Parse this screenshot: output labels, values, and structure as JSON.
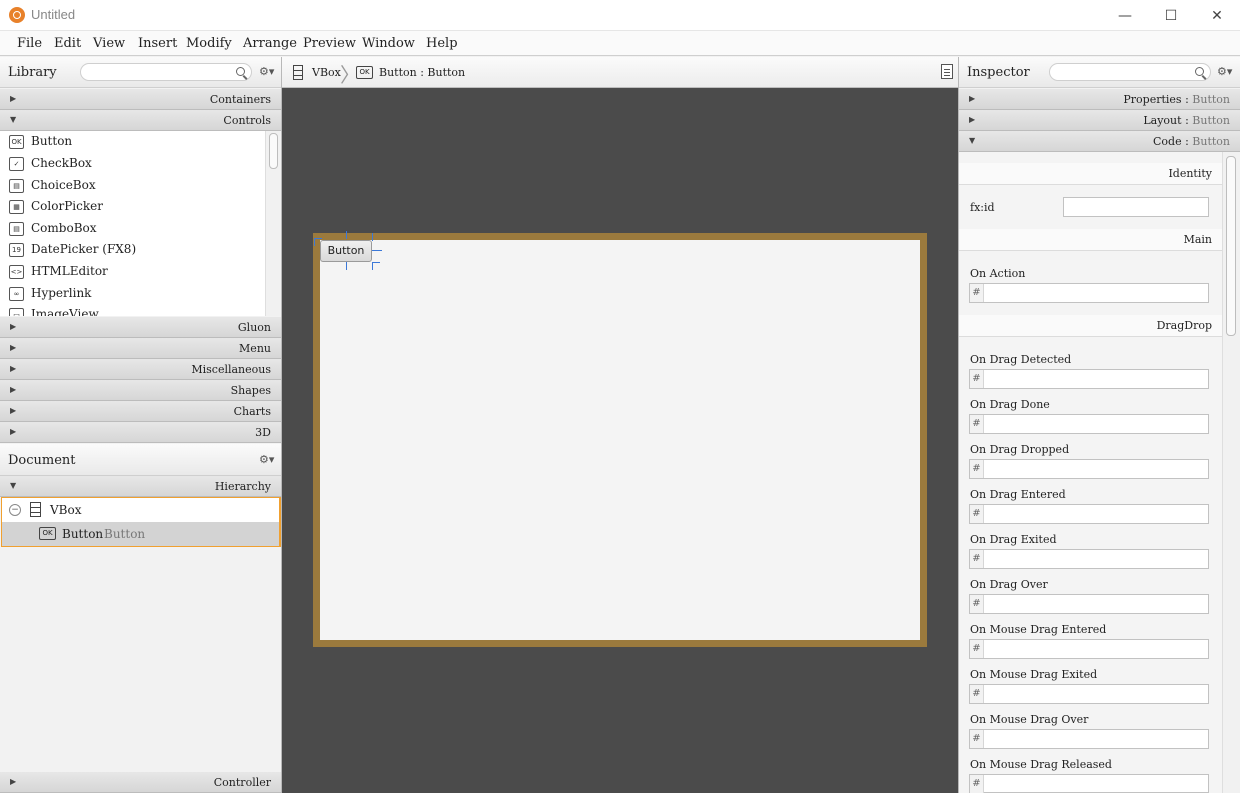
{
  "window": {
    "title": "Untitled",
    "controls": [
      "minimize",
      "maximize",
      "close"
    ]
  },
  "menu": [
    "File",
    "Edit",
    "View",
    "Insert",
    "Modify",
    "Arrange",
    "Preview",
    "Window",
    "Help"
  ],
  "library": {
    "title": "Library",
    "search_placeholder": "",
    "sections_top": [
      "Containers",
      "Controls"
    ],
    "controls": [
      {
        "label": "Button",
        "icon": "OK"
      },
      {
        "label": "CheckBox",
        "icon": "✓"
      },
      {
        "label": "ChoiceBox",
        "icon": "▤"
      },
      {
        "label": "ColorPicker",
        "icon": "▦"
      },
      {
        "label": "ComboBox",
        "icon": "▤"
      },
      {
        "label": "DatePicker  (FX8)",
        "icon": "19"
      },
      {
        "label": "HTMLEditor",
        "icon": "<>"
      },
      {
        "label": "Hyperlink",
        "icon": "∞"
      },
      {
        "label": "ImageView",
        "icon": "▭"
      }
    ],
    "sections_bottom": [
      "Gluon",
      "Menu",
      "Miscellaneous",
      "Shapes",
      "Charts",
      "3D"
    ]
  },
  "document": {
    "title": "Document",
    "hierarchy_label": "Hierarchy",
    "tree": [
      {
        "label": "VBox",
        "type": ""
      },
      {
        "label": "Button",
        "type": "Button"
      }
    ],
    "controller_label": "Controller"
  },
  "breadcrumb": [
    {
      "label": "VBox"
    },
    {
      "label": "Button : Button",
      "icon": "OK"
    }
  ],
  "canvas": {
    "button_label": "Button"
  },
  "inspector": {
    "title": "Inspector",
    "sections": [
      {
        "name": "Properties",
        "sub": "Button"
      },
      {
        "name": "Layout",
        "sub": "Button"
      },
      {
        "name": "Code",
        "sub": "Button"
      }
    ],
    "groups": {
      "identity": "Identity",
      "main": "Main",
      "dragdrop": "DragDrop"
    },
    "fxid_label": "fx:id",
    "on_action_label": "On Action",
    "events": [
      "On Drag Detected",
      "On Drag Done",
      "On Drag Dropped",
      "On Drag Entered",
      "On Drag Exited",
      "On Drag Over",
      "On Mouse Drag Entered",
      "On Mouse Drag Exited",
      "On Mouse Drag Over",
      "On Mouse Drag Released"
    ],
    "hash": "#"
  },
  "colors": {
    "canvas_bg": "#4b4b4b",
    "vbox_border": "#9b7a3d",
    "selection": "#f0a030",
    "handles": "#3b78d8"
  }
}
